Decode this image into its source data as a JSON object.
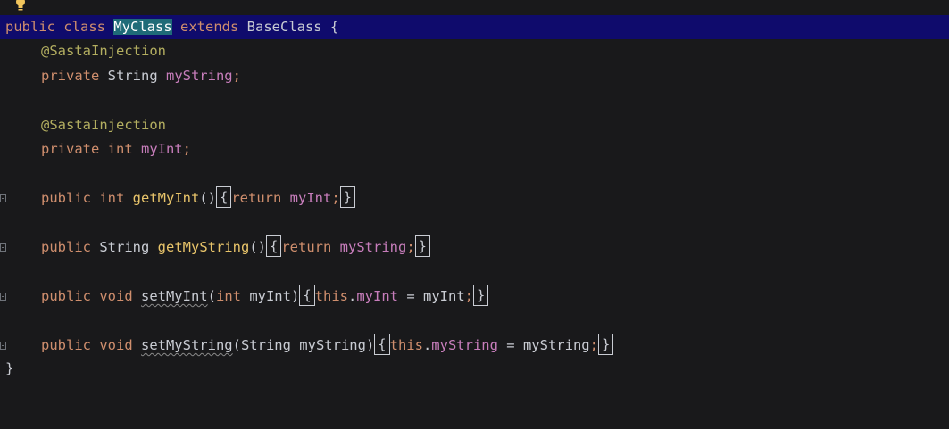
{
  "editor": {
    "lines": {
      "l1": {
        "kw1": "public class ",
        "cls": "MyClass",
        "kw2": " extends ",
        "base": "BaseClass {"
      },
      "l2": {
        "ann": "@SastaInjection"
      },
      "l3": {
        "kw": "private ",
        "type": "String ",
        "fld": "myString",
        "semi": ";"
      },
      "l5": {
        "ann": "@SastaInjection"
      },
      "l6": {
        "kw": "private int ",
        "fld": "myInt",
        "semi": ";"
      },
      "l8": {
        "kw": "public int ",
        "fn": "getMyInt",
        "parens": "()",
        "ob": "{",
        "ret": "return ",
        "fld": "myInt",
        "semi": ";",
        "cb": "}"
      },
      "l10": {
        "kw": "public ",
        "type": "String ",
        "fn": "getMyString",
        "parens": "()",
        "ob": "{",
        "ret": "return ",
        "fld": "myString",
        "semi": ";",
        "cb": "}"
      },
      "l12": {
        "kw": "public void ",
        "fn": "setMyInt",
        "p1": "(",
        "pkw": "int ",
        "param": "myInt)",
        "ob": "{",
        "this": "this",
        "dot": ".",
        "fld": "myInt",
        "assign": " = myInt",
        "semi": ";",
        "cb": "}"
      },
      "l14": {
        "kw": "public void ",
        "fn": "setMyString",
        "p1": "(String myString)",
        "ob": "{",
        "this": "this",
        "dot": ".",
        "fld": "myString",
        "assign": " = myString",
        "semi": ";",
        "cb": "}"
      },
      "l15": {
        "close": "}"
      }
    },
    "icons": {
      "intention": "lightbulb-icon",
      "fold": "fold-marker-icon"
    },
    "colors": {
      "background": "#19191b",
      "highlight_line": "#0f0b6c",
      "selection": "#1f6b78",
      "keyword": "#cf8e6d",
      "annotation": "#b3ae60",
      "field": "#c77dbb",
      "method": "#e8c46a",
      "text": "#c9ccd3"
    }
  }
}
